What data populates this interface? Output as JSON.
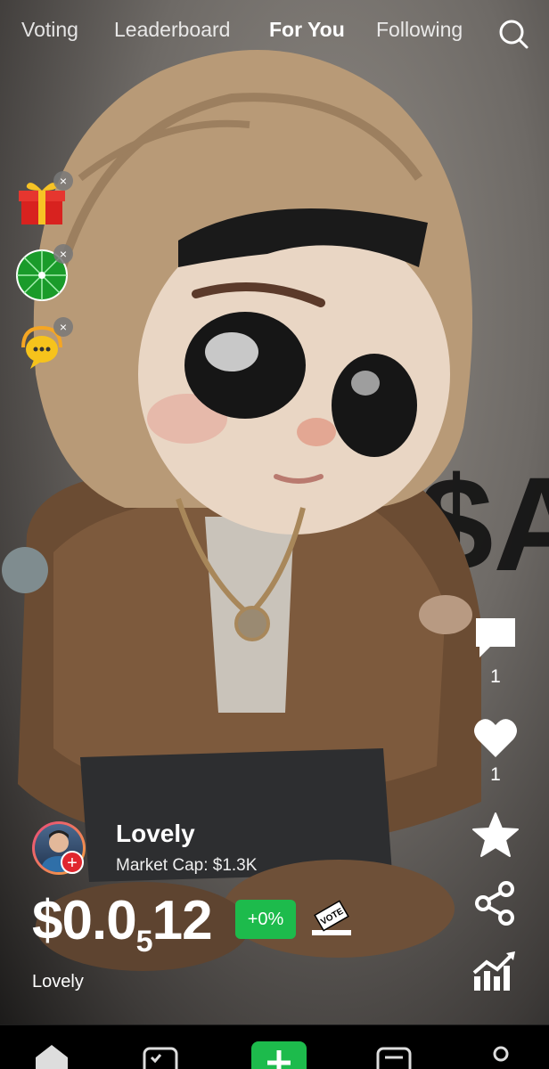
{
  "top_nav": {
    "tabs": [
      {
        "label": "Voting"
      },
      {
        "label": "Leaderboard"
      },
      {
        "label": "For You",
        "active": true
      },
      {
        "label": "Following"
      }
    ],
    "search_icon": "search-icon"
  },
  "left_widgets": [
    {
      "icon": "gift-icon",
      "close": "×"
    },
    {
      "icon": "wheel-icon",
      "close": "×"
    },
    {
      "icon": "support-chat-icon",
      "close": "×"
    }
  ],
  "actions": {
    "comments_count": "1",
    "likes_count": "1"
  },
  "post": {
    "creator_name": "Lovely",
    "market_cap": "Market Cap: $1.3K",
    "price_main": "$0.0",
    "price_subscript": "5",
    "price_tail": "12",
    "change": "+0%",
    "follow_symbol": "+",
    "caption": "Lovely"
  },
  "colors": {
    "accent_green": "#1dbb4c",
    "follow_red": "#e0262e"
  }
}
